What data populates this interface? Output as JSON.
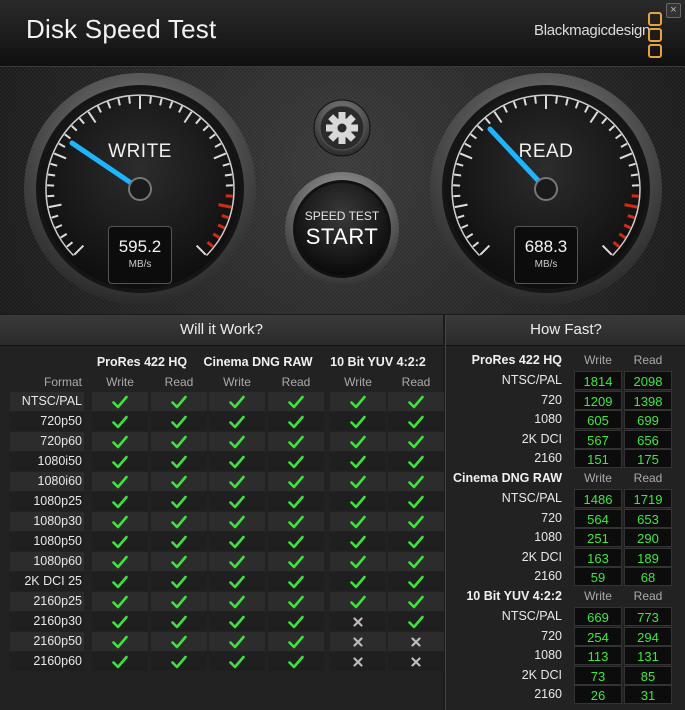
{
  "window": {
    "title": "Disk Speed Test",
    "brand": "Blackmagicdesign",
    "close_glyph": "×"
  },
  "gauges": {
    "write": {
      "label": "WRITE",
      "value": "595.2",
      "unit": "MB/s"
    },
    "read": {
      "label": "READ",
      "value": "688.3",
      "unit": "MB/s"
    }
  },
  "start_button": {
    "small_label": "SPEED TEST",
    "big_label": "START"
  },
  "settings_button": {
    "icon": "gear-icon"
  },
  "will_it_work": {
    "header": "Will it Work?",
    "format_label": "Format",
    "codecs": [
      "ProRes 422 HQ",
      "Cinema DNG RAW",
      "10 Bit YUV 4:2:2"
    ],
    "col_labels": [
      "Write",
      "Read",
      "Write",
      "Read",
      "Write",
      "Read"
    ],
    "rows": [
      {
        "format": "NTSC/PAL",
        "cells": [
          "check",
          "check",
          "check",
          "check",
          "check",
          "check"
        ]
      },
      {
        "format": "720p50",
        "cells": [
          "check",
          "check",
          "check",
          "check",
          "check",
          "check"
        ]
      },
      {
        "format": "720p60",
        "cells": [
          "check",
          "check",
          "check",
          "check",
          "check",
          "check"
        ]
      },
      {
        "format": "1080i50",
        "cells": [
          "check",
          "check",
          "check",
          "check",
          "check",
          "check"
        ]
      },
      {
        "format": "1080i60",
        "cells": [
          "check",
          "check",
          "check",
          "check",
          "check",
          "check"
        ]
      },
      {
        "format": "1080p25",
        "cells": [
          "check",
          "check",
          "check",
          "check",
          "check",
          "check"
        ]
      },
      {
        "format": "1080p30",
        "cells": [
          "check",
          "check",
          "check",
          "check",
          "check",
          "check"
        ]
      },
      {
        "format": "1080p50",
        "cells": [
          "check",
          "check",
          "check",
          "check",
          "check",
          "check"
        ]
      },
      {
        "format": "1080p60",
        "cells": [
          "check",
          "check",
          "check",
          "check",
          "check",
          "check"
        ]
      },
      {
        "format": "2K DCI 25",
        "cells": [
          "check",
          "check",
          "check",
          "check",
          "check",
          "check"
        ]
      },
      {
        "format": "2160p25",
        "cells": [
          "check",
          "check",
          "check",
          "check",
          "check",
          "check"
        ]
      },
      {
        "format": "2160p30",
        "cells": [
          "check",
          "check",
          "check",
          "check",
          "cross",
          "check"
        ]
      },
      {
        "format": "2160p50",
        "cells": [
          "check",
          "check",
          "check",
          "check",
          "cross",
          "cross"
        ]
      },
      {
        "format": "2160p60",
        "cells": [
          "check",
          "check",
          "check",
          "check",
          "cross",
          "cross"
        ]
      }
    ]
  },
  "how_fast": {
    "header": "How Fast?",
    "sections": [
      {
        "codec": "ProRes 422 HQ",
        "write_label": "Write",
        "read_label": "Read",
        "rows": [
          {
            "res": "NTSC/PAL",
            "write": "1814",
            "read": "2098"
          },
          {
            "res": "720",
            "write": "1209",
            "read": "1398"
          },
          {
            "res": "1080",
            "write": "605",
            "read": "699"
          },
          {
            "res": "2K DCI",
            "write": "567",
            "read": "656"
          },
          {
            "res": "2160",
            "write": "151",
            "read": "175"
          }
        ]
      },
      {
        "codec": "Cinema DNG RAW",
        "write_label": "Write",
        "read_label": "Read",
        "rows": [
          {
            "res": "NTSC/PAL",
            "write": "1486",
            "read": "1719"
          },
          {
            "res": "720",
            "write": "564",
            "read": "653"
          },
          {
            "res": "1080",
            "write": "251",
            "read": "290"
          },
          {
            "res": "2K DCI",
            "write": "163",
            "read": "189"
          },
          {
            "res": "2160",
            "write": "59",
            "read": "68"
          }
        ]
      },
      {
        "codec": "10 Bit YUV 4:2:2",
        "write_label": "Write",
        "read_label": "Read",
        "rows": [
          {
            "res": "NTSC/PAL",
            "write": "669",
            "read": "773"
          },
          {
            "res": "720",
            "write": "254",
            "read": "294"
          },
          {
            "res": "1080",
            "write": "113",
            "read": "131"
          },
          {
            "res": "2K DCI",
            "write": "73",
            "read": "85"
          },
          {
            "res": "2160",
            "write": "26",
            "read": "31"
          }
        ]
      }
    ]
  },
  "colors": {
    "needle": "#1fb4ff",
    "check": "#3ee23e",
    "cross": "#bbbbbb",
    "number": "#3ee83e",
    "redzone": "#d42a10",
    "brand_logo": "#e8a040"
  }
}
